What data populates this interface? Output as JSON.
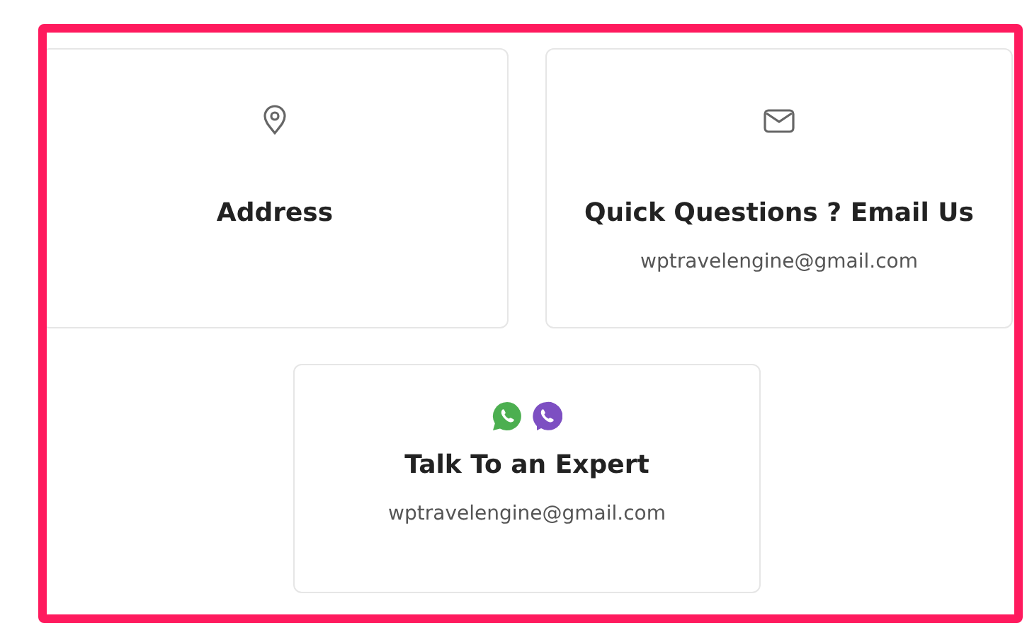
{
  "cards": [
    {
      "icons": [
        {
          "kind": "pin"
        }
      ],
      "title": "Address"
    },
    {
      "icons": [
        {
          "kind": "mail"
        }
      ],
      "title": "Quick Questions ? Email Us",
      "email": "wptravelengine@gmail.com"
    },
    {
      "icons": [
        {
          "kind": "whatsapp"
        },
        {
          "kind": "viber"
        }
      ],
      "title": "Talk To an Expert",
      "email": "wptravelengine@gmail.com"
    }
  ]
}
